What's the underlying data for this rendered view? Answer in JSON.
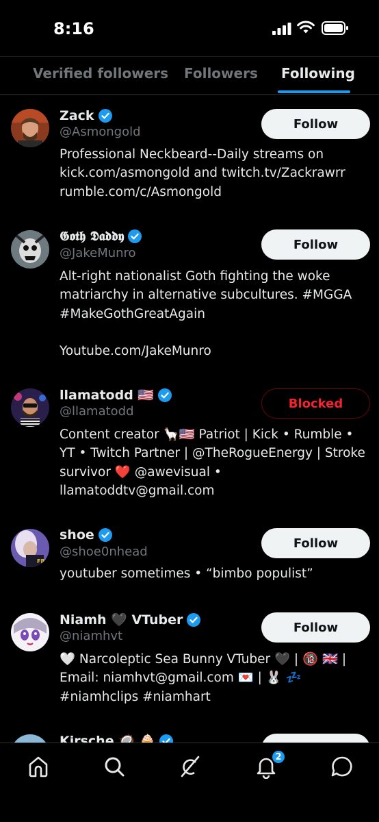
{
  "status_bar": {
    "time": "8:16"
  },
  "tabs": [
    {
      "label": "Verified followers",
      "active": false
    },
    {
      "label": "Followers",
      "active": false
    },
    {
      "label": "Following",
      "active": true
    }
  ],
  "users": [
    {
      "name": "Zack",
      "handle": "@Asmongold",
      "verified": true,
      "button": "Follow",
      "bio": "Professional Neckbeard--Daily streams on\nkick.com/asmongold and twitch.tv/Zackrawrr\nrumble.com/c/Asmongold"
    },
    {
      "name": "𝕲𝖔𝖙𝖍 𝕯𝖆𝖉𝖉𝖞",
      "handle": "@JakeMunro",
      "verified": true,
      "button": "Follow",
      "bio": "Alt-right nationalist Goth fighting the woke\nmatriarchy in alternative subcultures. #MGGA\n#MakeGothGreatAgain\n\nYoutube.com/JakeMunro"
    },
    {
      "name": "llamatodd 🇺🇸",
      "handle": "@llamatodd",
      "verified": true,
      "button": "Blocked",
      "bio": "Content creator 🦙🇺🇸 Patriot | Kick • Rumble •\nYT • Twitch Partner | @TheRogueEnergy | Stroke\nsurvivor ❤️ @awevisual •\nllamatoddtv@gmail.com"
    },
    {
      "name": "shoe",
      "handle": "@shoe0nhead",
      "verified": true,
      "button": "Follow",
      "bio": "youtuber sometimes • “bimbo populist”"
    },
    {
      "name": "Niamh 🖤 VTuber",
      "handle": "@niamhvt",
      "verified": true,
      "button": "Follow",
      "bio": "🤍 Narcoleptic Sea Bunny VTuber 🖤 | 🔞 🇬🇧 |\nEmail: niamhvt@gmail.com 💌 | 🐰 💤\n#niamhclips #niamhart"
    },
    {
      "name": "Kirsche 🥥 🧁",
      "handle": "",
      "verified": true,
      "button": "",
      "bio": ""
    }
  ],
  "nav": {
    "items": [
      "home-icon",
      "search-icon",
      "grok-icon",
      "notifications-icon",
      "messages-icon"
    ],
    "notification_count": "2"
  },
  "colors": {
    "background": "#000000",
    "accent": "#1d9bf0",
    "muted_text": "#71767b",
    "blocked_red": "#f4212e"
  }
}
